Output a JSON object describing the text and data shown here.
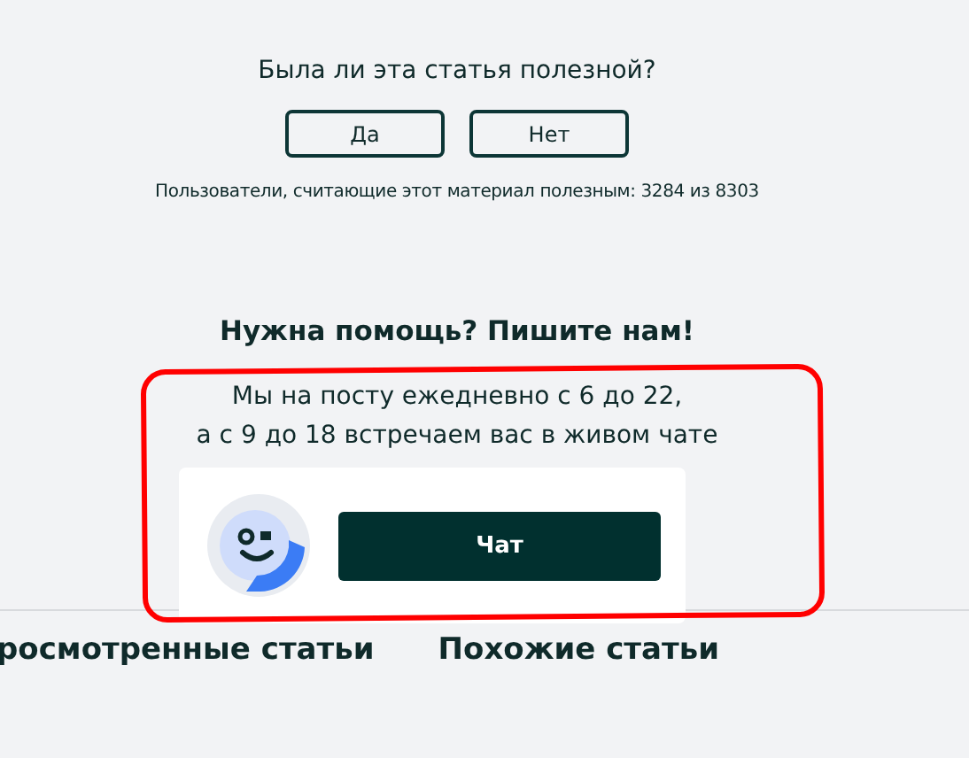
{
  "feedback": {
    "question": "Была ли эта статья полезной?",
    "buttons": [
      "Да",
      "Нет"
    ],
    "stats": "Пользователи, считающие этот материал полезным: 3284 из 8303"
  },
  "help": {
    "heading": "Нужна помощь? Пишите нам!",
    "lines": [
      "Мы на посту ежедневно с 6 до 22,",
      "а с 9 до 18 встречаем вас в живом чате"
    ],
    "chat_button": "Чат"
  },
  "bottom_tabs": [
    "росмотренные статьи",
    "Похожие статьи"
  ]
}
